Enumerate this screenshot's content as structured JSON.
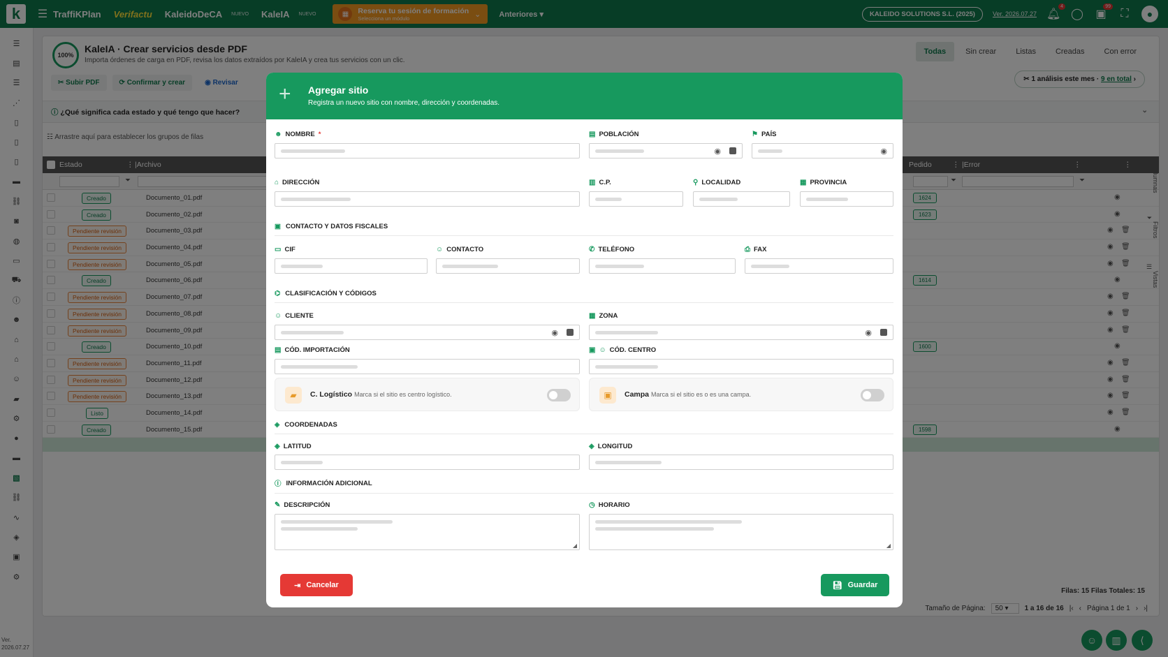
{
  "topbar": {
    "brand_traffic": "TraffiKPlan",
    "brand_verifactu": "Verifactu",
    "brand_decar": "KaleidoDeCA",
    "brand_ia": "KaleIA",
    "new_label": "NUEVO",
    "promo_title": "Reserva tu sesión de formación",
    "promo_sub": "Selecciona un módulo",
    "anteriores": "Anteriores",
    "company": "KALEIDO SOLUTIONS S.L. (2025)",
    "version": "Ver. 2026.07.27",
    "notif_count": "4",
    "msg_count": "99"
  },
  "sidebar": {
    "icons": [
      "list-icon",
      "box-icon",
      "list-icon",
      "nodes-icon",
      "doc-icon",
      "doc-icon",
      "doc-icon",
      "folder-icon",
      "link-icon",
      "camera-icon",
      "coins-icon",
      "card-icon",
      "truck-icon",
      "info-icon",
      "users-icon",
      "bank-icon",
      "bank-icon",
      "person-icon",
      "car-icon",
      "gear-icon",
      "circle-icon",
      "folder-icon",
      "kaleido-icon",
      "link-icon",
      "wave-icon",
      "robot-icon",
      "id-icon",
      "settings-icon"
    ],
    "version_label": "Ver.",
    "version_value": "2026.07.27"
  },
  "page": {
    "progress": "100%",
    "title": "KaleIA · Crear servicios desde PDF",
    "subtitle": "Importa órdenes de carga en PDF, revisa los datos extraídos por KaleIA y crea tus servicios con un clic.",
    "tabs": [
      "Todas",
      "Sin crear",
      "Listas",
      "Creadas",
      "Con error"
    ],
    "actions": {
      "upload": "Subir PDF",
      "confirm": "Confirmar y crear",
      "review": "Revisar"
    },
    "analysis_text": "1 análisis este mes · ",
    "analysis_link": "9 en total",
    "faq": "¿Qué significa cada estado y qué tengo que hacer?",
    "group_hint": "Arrastre aquí para establecer los grupos de filas"
  },
  "grid": {
    "columns": {
      "estado": "Estado",
      "archivo": "Archivo",
      "pedido": "Pedido",
      "error": "Error"
    },
    "rows": [
      {
        "estado": "Creado",
        "archivo": "Documento_01.pdf",
        "pedido": "1624",
        "type": "created"
      },
      {
        "estado": "Creado",
        "archivo": "Documento_02.pdf",
        "pedido": "1623",
        "type": "created"
      },
      {
        "estado": "Pendiente revisión",
        "archivo": "Documento_03.pdf",
        "pedido": "",
        "type": "pending"
      },
      {
        "estado": "Pendiente revisión",
        "archivo": "Documento_04.pdf",
        "pedido": "",
        "type": "pending"
      },
      {
        "estado": "Pendiente revisión",
        "archivo": "Documento_05.pdf",
        "pedido": "",
        "type": "pending"
      },
      {
        "estado": "Creado",
        "archivo": "Documento_06.pdf",
        "pedido": "1614",
        "type": "created"
      },
      {
        "estado": "Pendiente revisión",
        "archivo": "Documento_07.pdf",
        "pedido": "",
        "type": "pending"
      },
      {
        "estado": "Pendiente revisión",
        "archivo": "Documento_08.pdf",
        "pedido": "",
        "type": "pending"
      },
      {
        "estado": "Pendiente revisión",
        "archivo": "Documento_09.pdf",
        "pedido": "",
        "type": "pending"
      },
      {
        "estado": "Creado",
        "archivo": "Documento_10.pdf",
        "pedido": "1600",
        "type": "created"
      },
      {
        "estado": "Pendiente revisión",
        "archivo": "Documento_11.pdf",
        "pedido": "",
        "type": "pending"
      },
      {
        "estado": "Pendiente revisión",
        "archivo": "Documento_12.pdf",
        "pedido": "",
        "type": "pending"
      },
      {
        "estado": "Pendiente revisión",
        "archivo": "Documento_13.pdf",
        "pedido": "",
        "type": "pending"
      },
      {
        "estado": "Listo",
        "archivo": "Documento_14.pdf",
        "pedido": "",
        "type": "ready"
      },
      {
        "estado": "Creado",
        "archivo": "Documento_15.pdf",
        "pedido": "1598",
        "type": "created"
      }
    ],
    "side_tabs": [
      "Columnas",
      "Filtros",
      "Vistas"
    ],
    "rows_info": "Filas: 15  Filas Totales: 15",
    "page_size_label": "Tamaño de Página:",
    "page_size": "50",
    "range": "1 a 16 de 16",
    "page_info": "Página 1 de 1"
  },
  "modal": {
    "title": "Agregar sitio",
    "subtitle": "Registra un nuevo sitio con nombre, dirección y coordenadas.",
    "labels": {
      "nombre": "Nombre",
      "poblacion": "Población",
      "pais": "País",
      "direccion": "Dirección",
      "cp": "C.P.",
      "localidad": "Localidad",
      "provincia": "Provincia",
      "cif": "CIF",
      "contacto": "Contacto",
      "telefono": "Teléfono",
      "fax": "Fax",
      "cliente": "Cliente",
      "zona": "Zona",
      "cod_importacion": "Cód. importación",
      "cod_centro": "Cód. centro",
      "latitud": "Latitud",
      "longitud": "Longitud",
      "descripcion": "Descripción",
      "horario": "Horario"
    },
    "sections": {
      "contacto": "Contacto y datos fiscales",
      "clasificacion": "Clasificación y códigos",
      "coordenadas": "Coordenadas",
      "info": "Información adicional"
    },
    "toggles": {
      "logistico_title": "C. Logístico",
      "logistico_desc": "Marca si el sitio es centro logístico.",
      "campa_title": "Campa",
      "campa_desc": "Marca si el sitio es o es una campa."
    },
    "cancel": "Cancelar",
    "save": "Guardar"
  },
  "colors": {
    "primary": "#0f7a4d",
    "accent": "#17995e",
    "danger": "#e53935",
    "promo": "#f59a23"
  }
}
